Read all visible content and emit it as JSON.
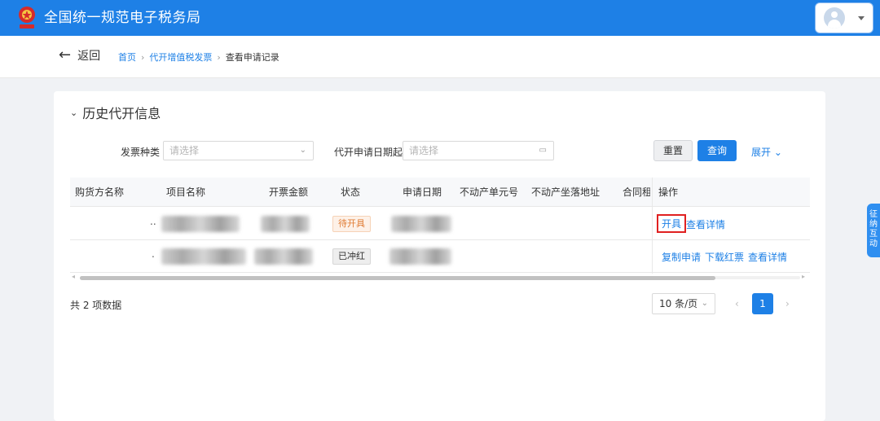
{
  "header": {
    "title": "全国统一规范电子税务局",
    "logo_icon": "tax-emblem-icon",
    "user_icon": "user-avatar-icon",
    "brand_color": "#1e80e6"
  },
  "nav": {
    "back_label": "返回",
    "breadcrumb": [
      "首页",
      "代开增值税发票",
      "查看申请记录"
    ]
  },
  "section": {
    "title": "历史代开信息"
  },
  "filters": {
    "invoice_type_label": "发票种类",
    "invoice_type_placeholder": "请选择",
    "apply_date_label": "代开申请日期起",
    "apply_date_placeholder": "请选择",
    "reset_label": "重置",
    "query_label": "查询",
    "expand_label": "展开"
  },
  "table": {
    "columns": [
      "购货方名称",
      "项目名称",
      "开票金额",
      "状态",
      "申请日期",
      "不动产单元号",
      "不动产坐落地址",
      "合同租赁",
      "操作"
    ],
    "rows": [
      {
        "buyer_suffix": "..",
        "status": "待开具",
        "actions": [
          "开具",
          "查看详情"
        ]
      },
      {
        "buyer_suffix": ".",
        "status": "已冲红",
        "actions": [
          "复制申请",
          "下载红票",
          "查看详情"
        ]
      }
    ]
  },
  "pagination": {
    "total_text": "共 2 项数据",
    "page_size": "10 条/页",
    "current_page": "1"
  },
  "side_tab": {
    "chars": [
      "征",
      "纳",
      "互",
      "动"
    ]
  }
}
